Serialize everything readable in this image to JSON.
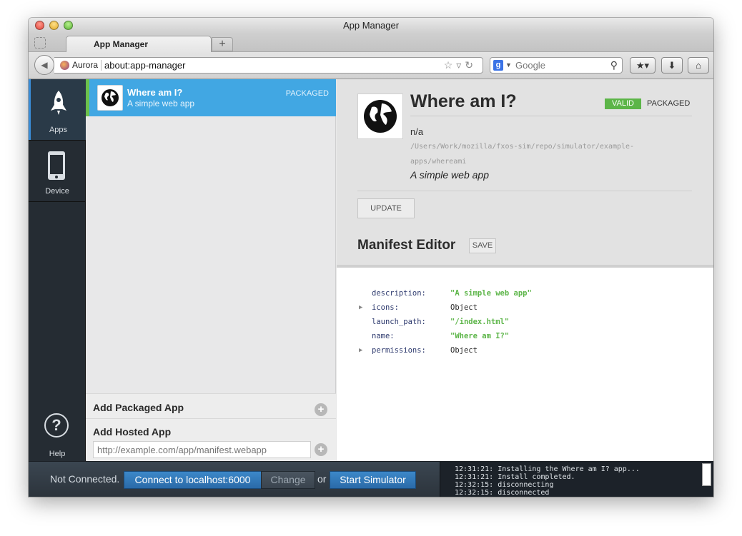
{
  "window": {
    "title": "App Manager"
  },
  "tabs": [
    {
      "label": "App Manager"
    }
  ],
  "newtab_label": "+",
  "navbar": {
    "browser_brand": "Aurora",
    "url": "about:app-manager",
    "url_icons": "☆▿↻",
    "search_placeholder": "Google",
    "search_engine_letter": "g"
  },
  "sidebar": {
    "items": [
      {
        "label": "Apps",
        "icon": "rocket-icon",
        "active": true
      },
      {
        "label": "Device",
        "icon": "phone-icon",
        "active": false
      }
    ],
    "help_label": "Help",
    "help_glyph": "?"
  },
  "applist": {
    "items": [
      {
        "name": "Where am I?",
        "description": "A simple web app",
        "type": "PACKAGED",
        "selected": true
      }
    ],
    "add_packaged_label": "Add Packaged App",
    "add_hosted_label": "Add Hosted App",
    "hosted_placeholder": "http://example.com/app/manifest.webapp"
  },
  "detail": {
    "title": "Where am I?",
    "status_badge": "VALID",
    "type_badge": "PACKAGED",
    "version": "n/a",
    "path": "/Users/Work/mozilla/fxos-sim/repo/simulator/example-apps/whereami",
    "description": "A simple web app",
    "update_label": "UPDATE",
    "manifest_title": "Manifest Editor",
    "save_label": "SAVE",
    "manifest": [
      {
        "key": "description:",
        "value": "\"A simple web app\"",
        "kind": "string",
        "expandable": false
      },
      {
        "key": "icons:",
        "value": "Object",
        "kind": "object",
        "expandable": true
      },
      {
        "key": "launch_path:",
        "value": "\"/index.html\"",
        "kind": "string",
        "expandable": false
      },
      {
        "key": "name:",
        "value": "\"Where am I?\"",
        "kind": "string",
        "expandable": false
      },
      {
        "key": "permissions:",
        "value": "Object",
        "kind": "object",
        "expandable": true
      }
    ]
  },
  "bottombar": {
    "status": "Not Connected.",
    "connect_label": "Connect to localhost:6000",
    "change_label": "Change",
    "or_label": "or",
    "simulator_label": "Start Simulator",
    "console": [
      "12:31:21: Installing the Where am I? app...",
      "12:31:21: Install completed.",
      "12:32:15: disconnecting",
      "12:32:15: disconnected"
    ]
  },
  "colors": {
    "accent": "#41a7e3",
    "valid": "#5cb548",
    "sidebar_bg": "#252c33",
    "button_blue": "#2f77b8"
  }
}
